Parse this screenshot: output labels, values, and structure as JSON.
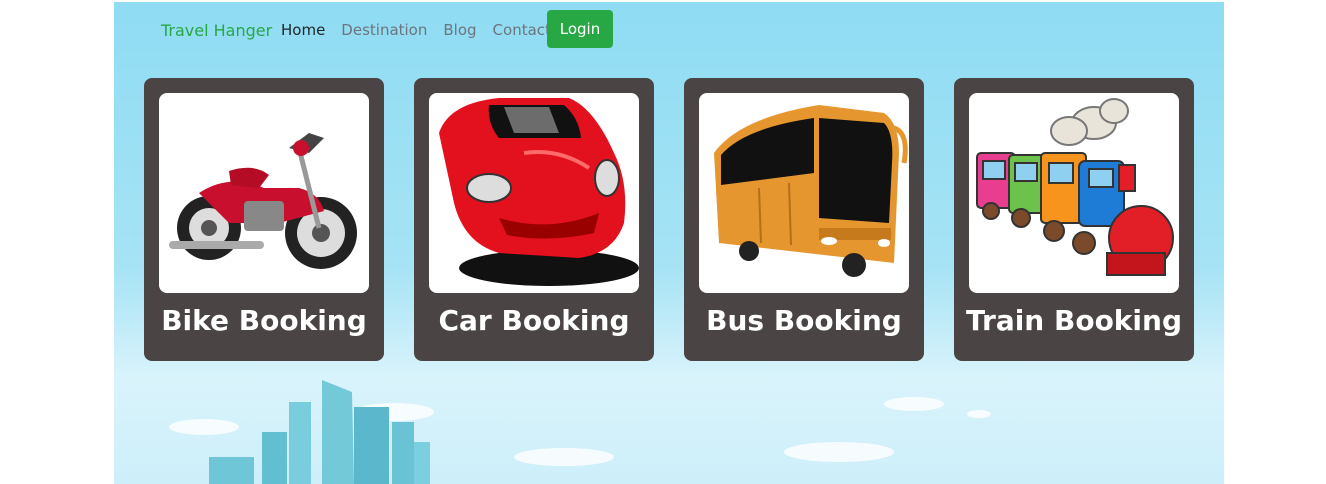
{
  "nav": {
    "brand": "Travel Hanger",
    "links": [
      "Home",
      "Destination",
      "Blog",
      "Contact"
    ],
    "active": "Home",
    "login_label": "Login"
  },
  "colors": {
    "accent": "#28a745",
    "card_bg": "#4a4444",
    "sky_top": "#8fdcf3"
  },
  "cards": [
    {
      "title": "Bike Booking",
      "icon": "motorcycle-icon"
    },
    {
      "title": "Car Booking",
      "icon": "sports-car-icon"
    },
    {
      "title": "Bus Booking",
      "icon": "bus-icon"
    },
    {
      "title": "Train Booking",
      "icon": "toy-train-icon"
    }
  ]
}
